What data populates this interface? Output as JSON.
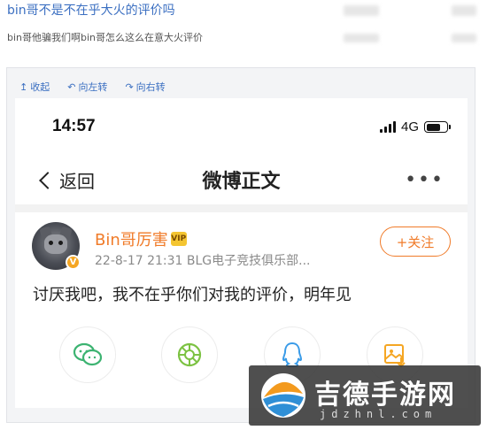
{
  "post": {
    "title": "bin哥不是不在乎大火的评价吗",
    "subtitle": "bin哥他骗我们啊bin哥怎么这么在意大火评价"
  },
  "image_toolbar": {
    "collapse": "收起",
    "rotate_left": "向左转",
    "rotate_right": "向右转"
  },
  "phone": {
    "status": {
      "time": "14:57",
      "network": "4G",
      "battery_level": 0.7
    },
    "nav": {
      "back": "返回",
      "title": "微博正文",
      "more": "•••"
    },
    "weibo": {
      "username": "Bin哥厉害",
      "vip_badge": "VIP",
      "meta": "22-8-17 21:31  BLG电子竞技俱乐部...",
      "follow": "+关注",
      "text": "讨厌我吧，我不在乎你们对我的评价，明年见"
    },
    "share_icons": [
      "wechat-icon",
      "moments-icon",
      "qq-icon",
      "image-save-icon"
    ]
  },
  "watermark": {
    "name": "吉德手游网",
    "url": "jdzhnl.com"
  },
  "colors": {
    "link": "#3b6fc1",
    "accent": "#f07b29",
    "vip": "#f4c531"
  }
}
